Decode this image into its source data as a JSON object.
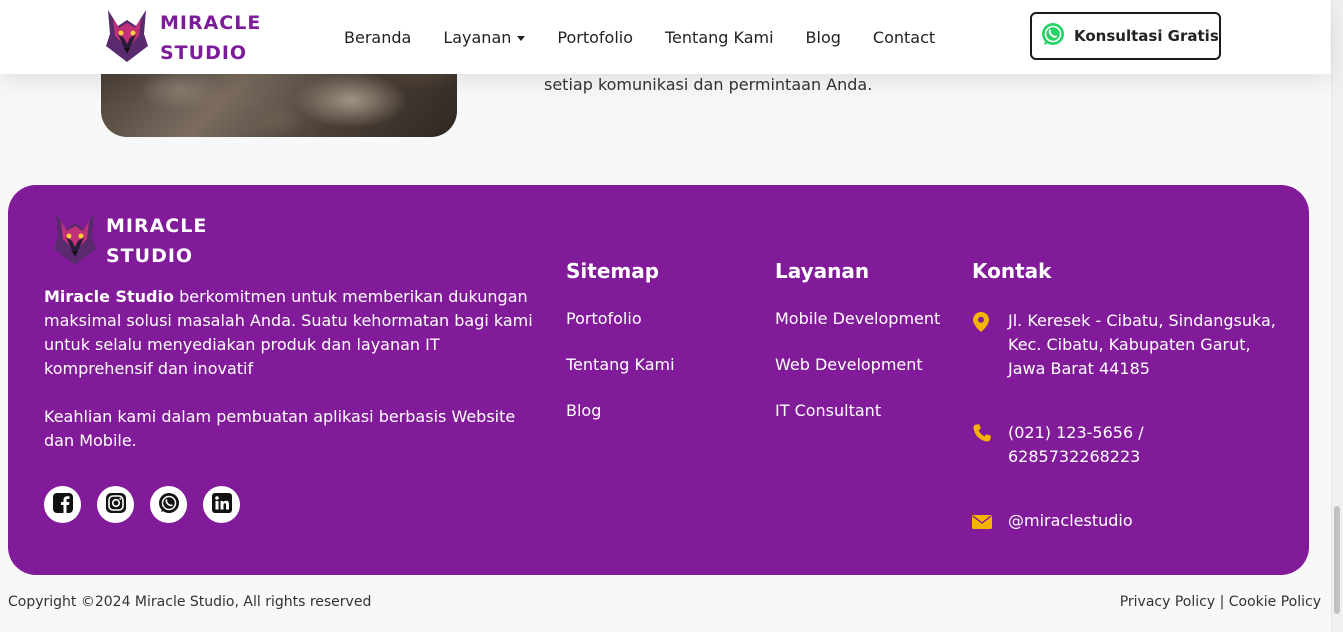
{
  "header": {
    "brand_line1": "MIRACLE",
    "brand_line2": "STUDIO",
    "nav": [
      "Beranda",
      "Layanan",
      "Portofolio",
      "Tentang Kami",
      "Blog",
      "Contact"
    ],
    "cta_label": "Konsultasi Gratis"
  },
  "content": {
    "text": "setiap komunikasi dan permintaan Anda."
  },
  "footer": {
    "brand_line1": "MIRACLE",
    "brand_line2": "STUDIO",
    "about_strong": "Miracle Studio",
    "about_rest": " berkomitmen untuk memberikan dukungan maksimal solusi masalah Anda. Suatu kehormatan bagi kami untuk selalu menyediakan produk dan layanan IT komprehensif dan inovatif",
    "about_second": "Keahlian kami dalam pembuatan aplikasi berbasis Website dan Mobile.",
    "sitemap": {
      "title": "Sitemap",
      "links": [
        "Portofolio",
        "Tentang Kami",
        "Blog"
      ]
    },
    "services": {
      "title": "Layanan",
      "links": [
        "Mobile Development",
        "Web Development",
        "IT Consultant"
      ]
    },
    "contact": {
      "title": "Kontak",
      "address": "Jl. Keresek - Cibatu, Sindangsuka, Kec. Cibatu, Kabupaten Garut, Jawa Barat 44185",
      "phone": "(021) 123-5656 / 6285732268223",
      "email": "@miraclestudio"
    },
    "social_icons": [
      "facebook-icon",
      "instagram-icon",
      "whatsapp-icon",
      "linkedin-icon"
    ]
  },
  "bottom": {
    "copyright": "Copyright ©2024 Miracle Studio, All rights reserved",
    "privacy": "Privacy Policy",
    "separator": "|",
    "cookie": "Cookie Policy"
  },
  "colors": {
    "brand_purple": "#821b9a",
    "accent_yellow": "#f5b400"
  }
}
